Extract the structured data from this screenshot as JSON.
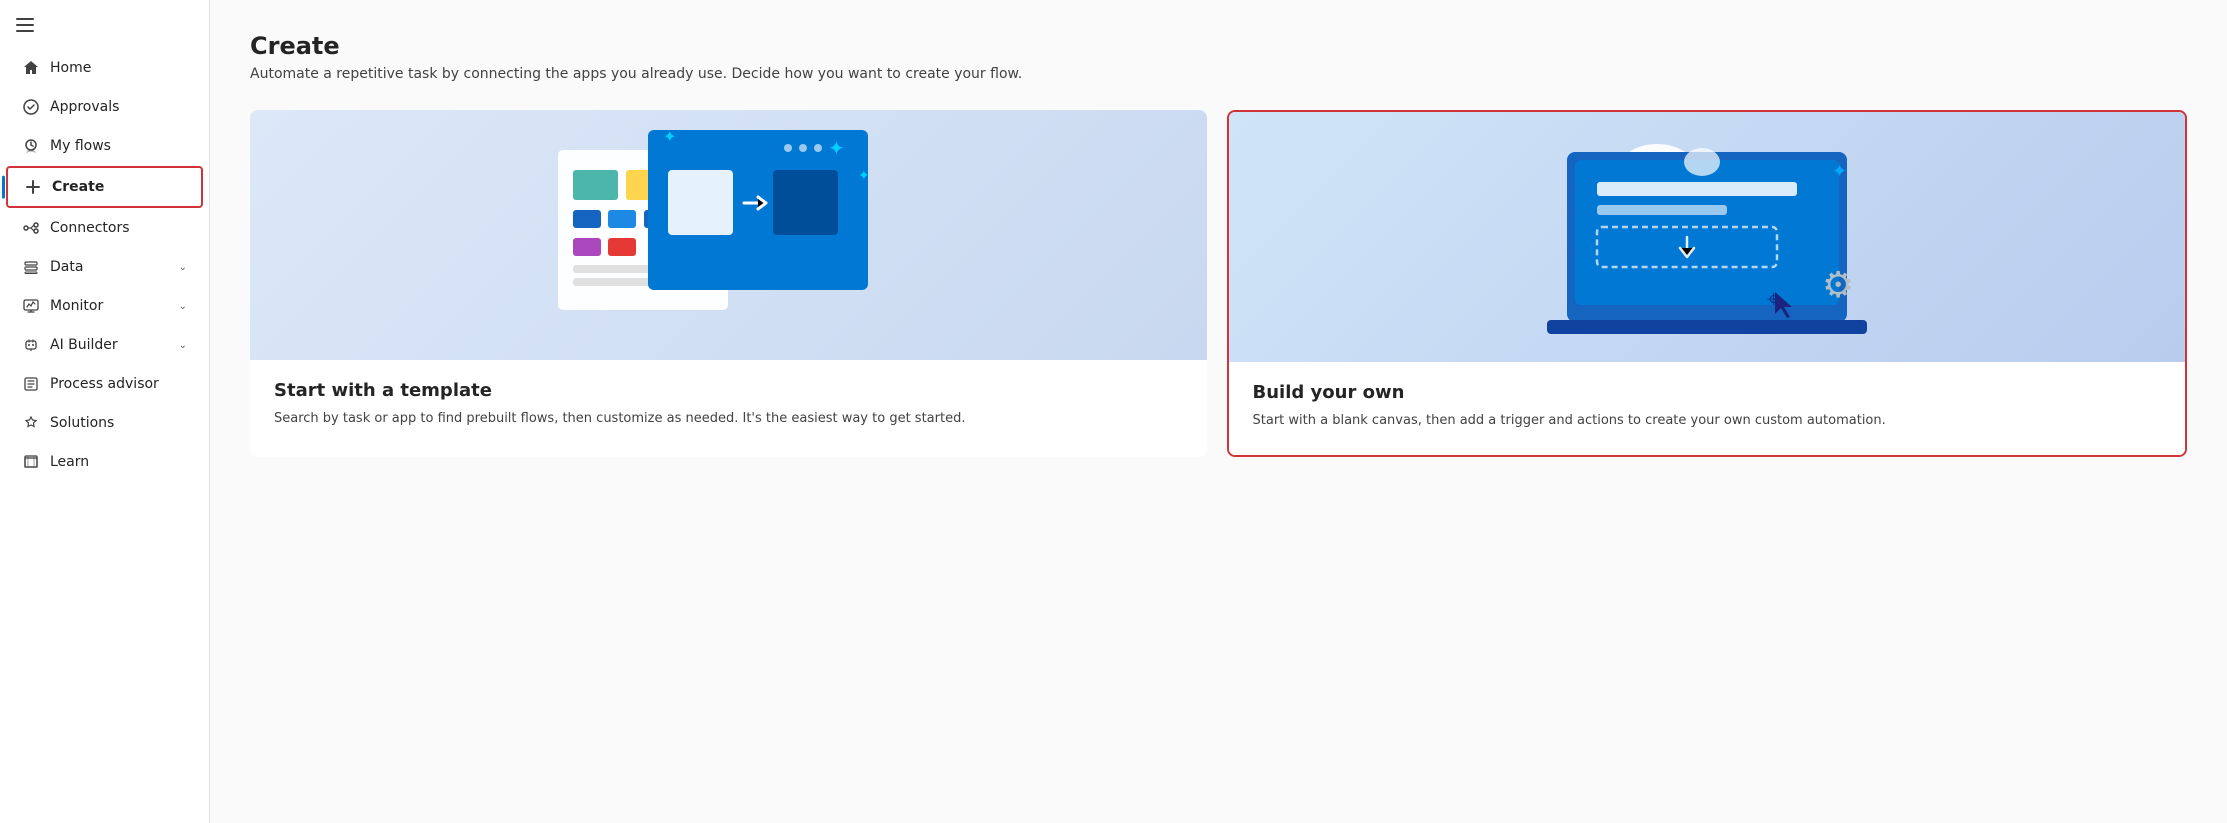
{
  "sidebar": {
    "hamburger_label": "Menu",
    "items": [
      {
        "id": "home",
        "label": "Home",
        "icon": "🏠",
        "has_chevron": false,
        "active": false
      },
      {
        "id": "approvals",
        "label": "Approvals",
        "icon": "✔",
        "has_chevron": false,
        "active": false
      },
      {
        "id": "my-flows",
        "label": "My flows",
        "icon": "↻",
        "has_chevron": false,
        "active": false
      },
      {
        "id": "create",
        "label": "Create",
        "icon": "+",
        "has_chevron": false,
        "active": true
      },
      {
        "id": "connectors",
        "label": "Connectors",
        "icon": "⚡",
        "has_chevron": false,
        "active": false
      },
      {
        "id": "data",
        "label": "Data",
        "icon": "🗄",
        "has_chevron": true,
        "active": false
      },
      {
        "id": "monitor",
        "label": "Monitor",
        "icon": "📊",
        "has_chevron": true,
        "active": false
      },
      {
        "id": "ai-builder",
        "label": "AI Builder",
        "icon": "🤖",
        "has_chevron": true,
        "active": false
      },
      {
        "id": "process-advisor",
        "label": "Process advisor",
        "icon": "📋",
        "has_chevron": false,
        "active": false
      },
      {
        "id": "solutions",
        "label": "Solutions",
        "icon": "💡",
        "has_chevron": false,
        "active": false
      },
      {
        "id": "learn",
        "label": "Learn",
        "icon": "📖",
        "has_chevron": false,
        "active": false
      }
    ]
  },
  "main": {
    "title": "Create",
    "subtitle": "Automate a repetitive task by connecting the apps you already use. Decide how you want to create your flow.",
    "cards": [
      {
        "id": "template",
        "title": "Start with a template",
        "description": "Search by task or app to find prebuilt flows, then customize as needed. It's the easiest way to get started.",
        "highlighted": false
      },
      {
        "id": "build-own",
        "title": "Build your own",
        "description": "Start with a blank canvas, then add a trigger and actions to create your own custom automation.",
        "highlighted": true
      }
    ]
  }
}
